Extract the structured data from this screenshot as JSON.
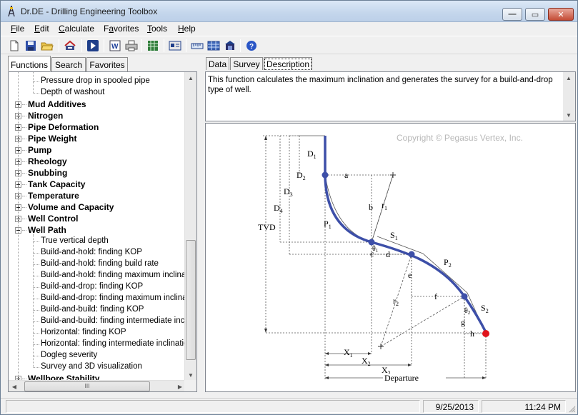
{
  "window": {
    "title": "Dr.DE - Drilling Engineering Toolbox"
  },
  "menu": [
    {
      "label": "File",
      "key": "F",
      "rest": "ile"
    },
    {
      "label": "Edit",
      "key": "E",
      "rest": "dit"
    },
    {
      "label": "Calculate",
      "key": "C",
      "rest": "alculate"
    },
    {
      "label": "Favorites",
      "key": "a",
      "pre": "F",
      "rest": "vorites"
    },
    {
      "label": "Tools",
      "key": "T",
      "rest": "ools"
    },
    {
      "label": "Help",
      "key": "H",
      "rest": "elp"
    }
  ],
  "toolbar_icons": [
    "new-document-icon",
    "save-icon",
    "open-folder-icon",
    "print-setup-icon",
    "run-icon",
    "export-word-icon",
    "print-icon",
    "export-excel-icon",
    "unit-settings-icon",
    "ruler-icon",
    "calculator-icon",
    "about-icon",
    "help-icon"
  ],
  "left_tabs": [
    "Functions",
    "Search",
    "Favorites"
  ],
  "tree": {
    "items": [
      {
        "label": "Pressure drop in spooled pipe",
        "level": 2
      },
      {
        "label": "Depth of washout",
        "level": 2
      },
      {
        "label": "Mud Additives",
        "level": 1,
        "expander": "+"
      },
      {
        "label": "Nitrogen",
        "level": 1,
        "expander": "+"
      },
      {
        "label": "Pipe Deformation",
        "level": 1,
        "expander": "+"
      },
      {
        "label": "Pipe Weight",
        "level": 1,
        "expander": "+"
      },
      {
        "label": "Pump",
        "level": 1,
        "expander": "+"
      },
      {
        "label": "Rheology",
        "level": 1,
        "expander": "+"
      },
      {
        "label": "Snubbing",
        "level": 1,
        "expander": "+"
      },
      {
        "label": "Tank Capacity",
        "level": 1,
        "expander": "+"
      },
      {
        "label": "Temperature",
        "level": 1,
        "expander": "+"
      },
      {
        "label": "Volume and Capacity",
        "level": 1,
        "expander": "+"
      },
      {
        "label": "Well Control",
        "level": 1,
        "expander": "+"
      },
      {
        "label": "Well Path",
        "level": 1,
        "expander": "-"
      },
      {
        "label": "True vertical depth",
        "level": 2
      },
      {
        "label": "Build-and-hold: finding KOP",
        "level": 2
      },
      {
        "label": "Build-and-hold: finding build rate",
        "level": 2
      },
      {
        "label": "Build-and-hold: finding maximum inclination",
        "level": 2
      },
      {
        "label": "Build-and-drop: finding KOP",
        "level": 2
      },
      {
        "label": "Build-and-drop: finding maximum inclination",
        "level": 2,
        "selected": true
      },
      {
        "label": "Build-and-build: finding KOP",
        "level": 2
      },
      {
        "label": "Build-and-build: finding intermediate inclinat",
        "level": 2
      },
      {
        "label": "Horizontal: finding KOP",
        "level": 2
      },
      {
        "label": "Horizontal: finding intermediate inclination",
        "level": 2
      },
      {
        "label": "Dogleg severity",
        "level": 2
      },
      {
        "label": "Survey and 3D visualization",
        "level": 2
      },
      {
        "label": "Wellbore Stability",
        "level": 1,
        "expander": "+"
      }
    ],
    "hscroll_grip": "III"
  },
  "right_tabs": [
    "Data",
    "Survey",
    "Description"
  ],
  "description": "This function calculates the maximum inclination and generates the survey for a build-and-drop type of well.",
  "diagram": {
    "copyright": "Copyright © Pegasus Vertex, Inc.",
    "labels": {
      "D1": "D",
      "D1s": "1",
      "D2": "D",
      "D2s": "2",
      "D3": "D",
      "D3s": "3",
      "D4": "D",
      "D4s": "4",
      "TVD": "TVD",
      "a": "a",
      "b": "b",
      "r1": "r",
      "r1s": "1",
      "P1": "P",
      "P1s": "1",
      "S1": "S",
      "S1s": "1",
      "c": "c",
      "d": "d",
      "theta1": "θ",
      "theta1s": "1",
      "e": "e",
      "P2": "P",
      "P2s": "2",
      "f": "f",
      "r2": "r",
      "r2s": "2",
      "theta2": "θ",
      "theta2s": "2",
      "g": "g",
      "S2": "S",
      "S2s": "2",
      "h": "h",
      "X1": "X",
      "X1s": "1",
      "X2": "X",
      "X2s": "2",
      "X3": "X",
      "X3s": "3",
      "departure": "Departure"
    },
    "colors": {
      "path": "#3d4fa8",
      "endpoint": "#e0141c",
      "guide": "#555555"
    }
  },
  "status": {
    "cell1": "",
    "date": "9/25/2013",
    "time": "11:24 PM"
  }
}
